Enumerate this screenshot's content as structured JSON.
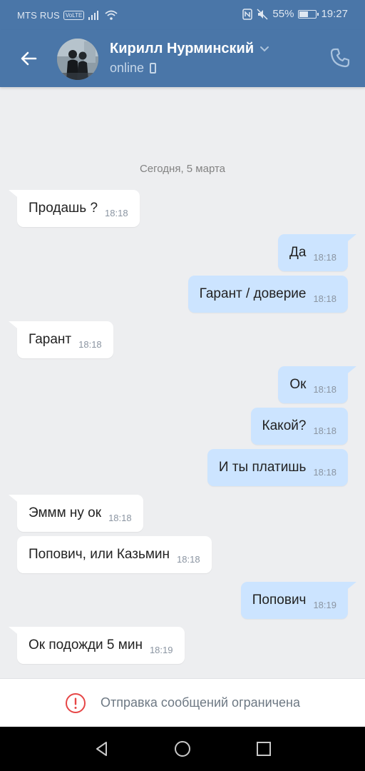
{
  "statusbar": {
    "carrier": "MTS RUS",
    "volte": "VoLTE",
    "battery_percent": "55%",
    "battery_level": 0.55,
    "time": "19:27"
  },
  "header": {
    "contact_name": "Кирилл Нурминский",
    "status": "online",
    "icons": [
      "back-arrow-icon",
      "chevron-down-icon",
      "mobile-phone-icon",
      "call-icon"
    ]
  },
  "chat": {
    "date_separator": "Сегодня, 5 марта",
    "messages": [
      {
        "dir": "in",
        "text": "Продашь ?",
        "time": "18:18"
      },
      {
        "dir": "out",
        "text": "Да",
        "time": "18:18"
      },
      {
        "dir": "out",
        "text": "Гарант / доверие",
        "time": "18:18"
      },
      {
        "dir": "in",
        "text": "Гарант",
        "time": "18:18"
      },
      {
        "dir": "out",
        "text": "Ок",
        "time": "18:18"
      },
      {
        "dir": "out",
        "text": "Какой?",
        "time": "18:18"
      },
      {
        "dir": "out",
        "text": "И ты платишь",
        "time": "18:18"
      },
      {
        "dir": "in",
        "text": "Эммм ну ок",
        "time": "18:18"
      },
      {
        "dir": "in",
        "text": "Попович, или Казьмин",
        "time": "18:18"
      },
      {
        "dir": "out",
        "text": "Попович",
        "time": "18:19"
      },
      {
        "dir": "in",
        "text": "Ок подожди 5 мин",
        "time": "18:19"
      }
    ]
  },
  "footer": {
    "restriction_text": "Отправка сообщений ограничена",
    "warning_color": "#e64646"
  },
  "colors": {
    "header": "#4a76a8",
    "outgoing_bubble": "#cce4ff",
    "incoming_bubble": "#ffffff",
    "background": "#edeef0"
  }
}
